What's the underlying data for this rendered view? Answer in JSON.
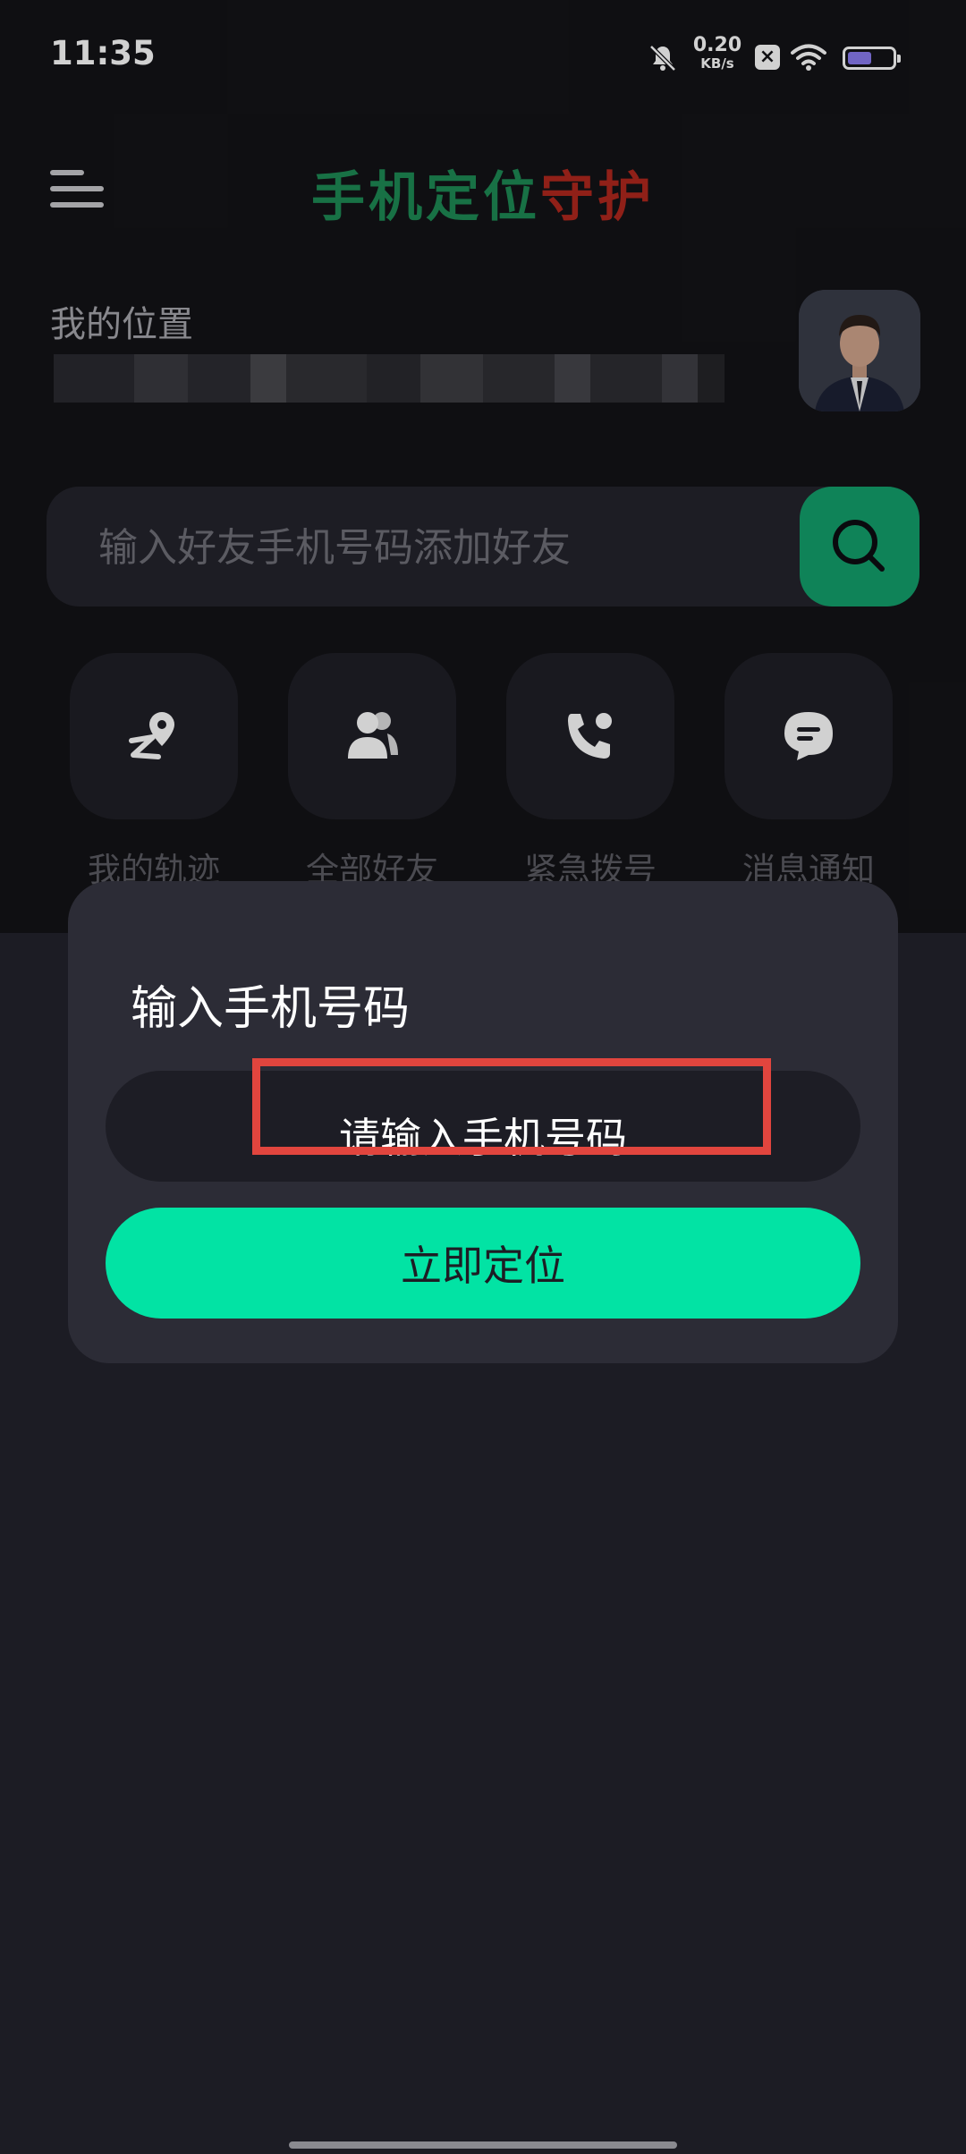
{
  "status_bar": {
    "time": "11:35",
    "net_speed_value": "0.20",
    "net_speed_unit": "KB/s",
    "battery_color": "#8a7cf0",
    "icons": [
      "bell-muted-icon",
      "close-badge-icon",
      "wifi-icon",
      "battery-icon"
    ]
  },
  "header": {
    "title_green": "手机定位",
    "title_red": "守护",
    "title_green_color": "#1e8a55",
    "title_red_color": "#b0281e"
  },
  "location": {
    "label": "我的位置",
    "address_pixelated": true
  },
  "search": {
    "placeholder": "输入好友手机号码添加好友",
    "button_color": "#13a06c"
  },
  "quick_actions": [
    {
      "label": "我的轨迹",
      "icon": "track-pin-icon"
    },
    {
      "label": "全部好友",
      "icon": "friends-icon"
    },
    {
      "label": "紧急拨号",
      "icon": "emergency-call-icon"
    },
    {
      "label": "消息通知",
      "icon": "message-icon"
    }
  ],
  "dialog": {
    "title": "输入手机号码",
    "phone_placeholder": "请输入手机号码",
    "phone_value": "",
    "submit_label": "立即定位",
    "submit_color": "#02e3a4",
    "highlight_color": "#e1453e"
  }
}
